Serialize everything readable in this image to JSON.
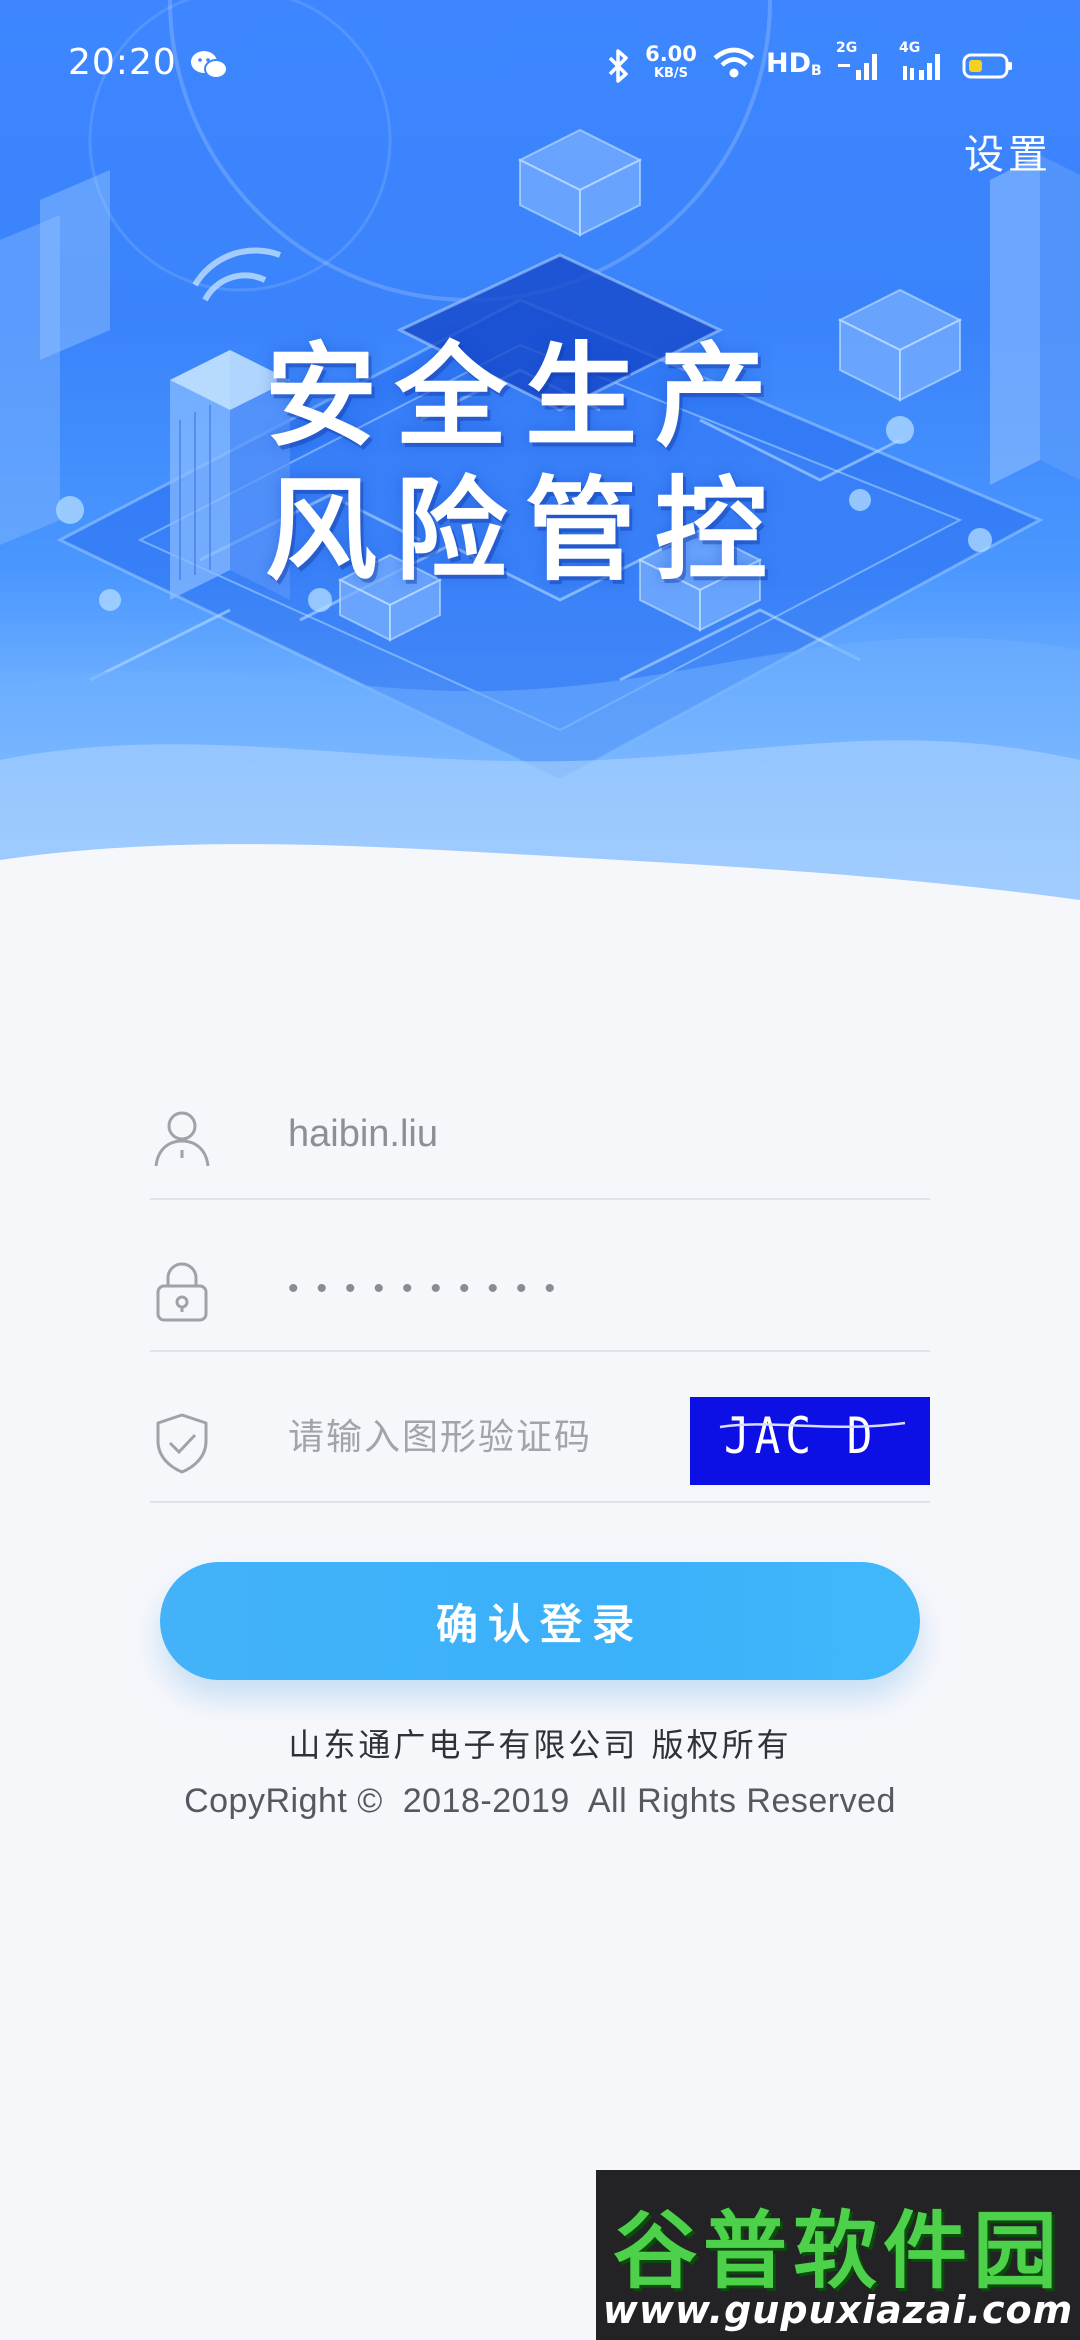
{
  "status_bar": {
    "time": "20:20",
    "net_speed_value": "6.00",
    "net_speed_unit": "KB/S",
    "hd_label": "HD",
    "hd_sub": "B",
    "sim1_tag": "2G",
    "sim2_tag": "4G",
    "icons": [
      "wechat-icon",
      "bluetooth-icon",
      "wifi-icon",
      "signal-icon",
      "battery-icon"
    ]
  },
  "header": {
    "settings_label": "设置",
    "title_line1": "安全生产",
    "title_line2": "风险管控"
  },
  "login_form": {
    "username_value": "haibin.liu",
    "password_value": "••••••••••",
    "captcha_placeholder": "请输入图形验证码",
    "captcha_image_text": "JAC D",
    "submit_label": "确认登录",
    "icons": [
      "user-icon",
      "lock-icon",
      "shield-check-icon"
    ]
  },
  "footer": {
    "company_line": "山东通广电子有限公司 版权所有",
    "copyright_line": "CopyRight ©  2018-2019  All Rights Reserved"
  },
  "watermark": {
    "title": "谷普软件园",
    "url": "www.gupuxiazai.com"
  },
  "colors": {
    "hero_blue": "#3d86ff",
    "button_blue": "#43b2f9",
    "captcha_bg": "#0d10e4",
    "page_bg": "#f6f7fb"
  }
}
